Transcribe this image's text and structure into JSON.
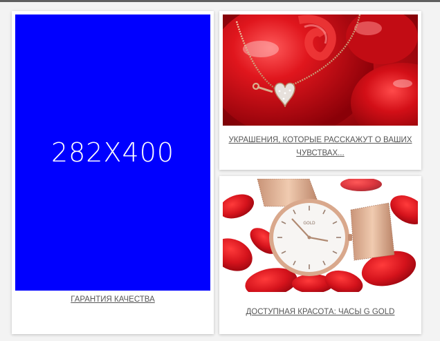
{
  "cards": [
    {
      "placeholder_text": "282X400",
      "caption": "ГАРАНТИЯ КАЧЕСТВА",
      "placeholder_color": "#0000ff"
    },
    {
      "caption": "УКРАШЕНИЯ, КОТОРЫЕ РАССКАЖУТ О ВАШИХ ЧУВСТВАХ..."
    },
    {
      "caption": "ДОСТУПНАЯ КРАСОТА: ЧАСЫ G GOLD",
      "watch_face_text": "GOLD"
    }
  ]
}
